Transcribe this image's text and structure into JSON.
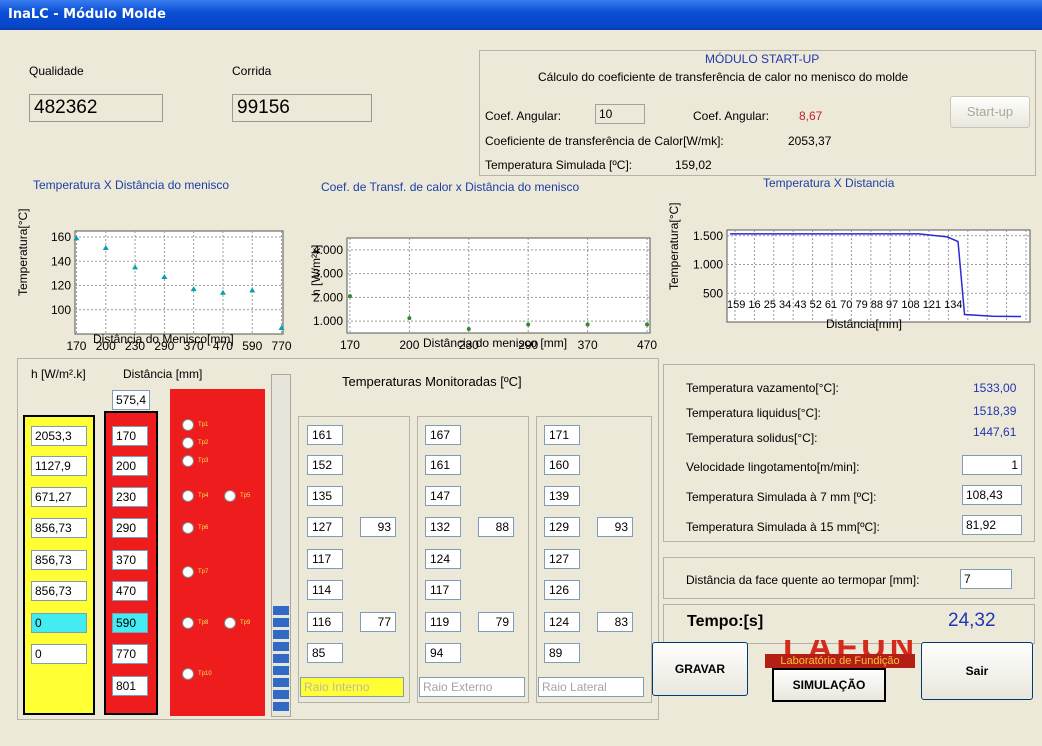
{
  "window": {
    "title": "InaLC - Módulo Molde"
  },
  "header": {
    "qualidade_label": "Qualidade",
    "qualidade_value": "482362",
    "corrida_label": "Corrida",
    "corrida_value": "99156"
  },
  "startup": {
    "title": "MÓDULO START-UP",
    "subtitle": "Cálculo do coeficiente de transferência de calor no menisco do molde",
    "coef_angular_label": "Coef. Angular:",
    "coef_angular_input": "10",
    "coef_angular2_label": "Coef. Angular:",
    "coef_angular2_value": "8,67",
    "coef_transf_label": "Coeficiente de transferência de Calor[W/mk]:",
    "coef_transf_value": "2053,37",
    "temp_sim_label": "Temperatura Simulada [ºC]:",
    "temp_sim_value": "159,02",
    "button": "Start-up"
  },
  "charts_text": {
    "c1": {
      "title": "Temperatura X Distância do menisco",
      "ylabel": "Temperatura[°C]",
      "xlabel": "Distância do Menisco[mm]",
      "yticks": [
        "160",
        "140",
        "120",
        "100"
      ],
      "xticks": [
        "170",
        "200",
        "230",
        "290",
        "370",
        "470",
        "590",
        "770"
      ]
    },
    "c2": {
      "title": "Coef. de Transf. de calor x Distância do menisco",
      "ylabel": "h [W/m²k]",
      "xlabel": "Distância do menisco [mm]",
      "yticks": [
        "4.000",
        "3.000",
        "2.000",
        "1.000"
      ],
      "xticks": [
        "170",
        "200",
        "230",
        "290",
        "370",
        "470"
      ]
    },
    "c3": {
      "title": "Temperatura X Distancia",
      "ylabel": "Temperatura[°C]",
      "xlabel": "Distância[mm]",
      "yticks": [
        "1.500",
        "1.000",
        "500"
      ],
      "xticks": "159 16 25 34 43 52 61 70 79 88 97 108 121 134"
    }
  },
  "chart_data": [
    {
      "type": "scatter",
      "title": "Temperatura X Distância do menisco",
      "xlabel": "Distância do Menisco[mm]",
      "ylabel": "Temperatura[°C]",
      "categories": [
        "170",
        "200",
        "230",
        "290",
        "370",
        "470",
        "590",
        "770"
      ],
      "values": [
        159,
        151,
        135,
        127,
        117,
        114,
        116,
        85
      ],
      "ylim": [
        80,
        165
      ],
      "grid": true,
      "color": "#0aa0b4"
    },
    {
      "type": "scatter",
      "title": "Coef. de Transf. de calor x Distância do menisco",
      "xlabel": "Distância do menisco [mm]",
      "ylabel": "h [W/m²k]",
      "categories": [
        "170",
        "200",
        "230",
        "290",
        "370",
        "470"
      ],
      "values": [
        2053,
        1128,
        671,
        857,
        857,
        857
      ],
      "ylim": [
        500,
        4500
      ],
      "grid": true,
      "color": "#2e8b2e"
    },
    {
      "type": "line",
      "title": "Temperatura X Distancia",
      "xlabel": "Distância[mm]",
      "ylabel": "Temperatura[°C]",
      "x": [
        0,
        87,
        100,
        105,
        108,
        121,
        134
      ],
      "values": [
        1533,
        1533,
        1480,
        1400,
        130,
        100,
        95
      ],
      "ylim": [
        0,
        1600
      ],
      "grid": true,
      "color": "#2a2ad8"
    }
  ],
  "table": {
    "h_header": "h [W/m².k]",
    "dist_header": "Distância [mm]",
    "dist_top": "575,4",
    "h_values": [
      "2053,3",
      "1127,9",
      "671,27",
      "856,73",
      "856,73",
      "856,73",
      "0",
      "0"
    ],
    "dist_values": [
      "170",
      "200",
      "230",
      "290",
      "370",
      "470",
      "590",
      "770",
      "801"
    ],
    "tp_labels": [
      "Tp1",
      "Tp2",
      "Tp3",
      "Tp4",
      "Tp5",
      "Tp6",
      "Tp7",
      "Tp8",
      "Tp9",
      "Tp10"
    ],
    "monitor_title": "Temperaturas Monitoradas [ºC]",
    "col1": [
      "161",
      "152",
      "135",
      "127",
      "117",
      "114",
      "116",
      "85"
    ],
    "col1_extra": {
      "r4": "93",
      "r7": "77"
    },
    "col2": [
      "167",
      "161",
      "147",
      "132",
      "124",
      "117",
      "119",
      "94"
    ],
    "col2_extra": {
      "r4": "88",
      "r7": "79"
    },
    "col3": [
      "171",
      "160",
      "139",
      "129",
      "127",
      "126",
      "124",
      "89"
    ],
    "col3_extra": {
      "r4": "93",
      "r7": "83"
    },
    "raio_interno": "Raio Interno",
    "raio_externo": "Raio Externo",
    "raio_lateral": "Raio Lateral"
  },
  "params": {
    "vazamento_label": "Temperatura vazamento[°C]:",
    "vazamento_value": "1533,00",
    "liquidus_label": "Temperatura liquidus[°C]:",
    "liquidus_value": "1518,39",
    "solidus_label": "Temperatura solidus[°C]:",
    "solidus_value": "1447,61",
    "velocidade_label": "Velocidade lingotamento[m/min]:",
    "velocidade_value": "1",
    "sim7_label": "Temperatura Simulada à 7 mm [ºC]:",
    "sim7_value": "108,43",
    "sim15_label": "Temperatura Simulada à 15 mm[ºC]:",
    "sim15_value": "81,92",
    "face_label": "Distância da face quente ao termopar [mm]:",
    "face_value": "7",
    "tempo_label": "Tempo:[s]",
    "tempo_value": "24,32"
  },
  "buttons": {
    "gravar": "GRAVAR",
    "simulacao": "SIMULAÇÃO",
    "sair": "Sair"
  },
  "logo": {
    "text": "LAFUN",
    "caption": "Laboratório de Fundição"
  }
}
